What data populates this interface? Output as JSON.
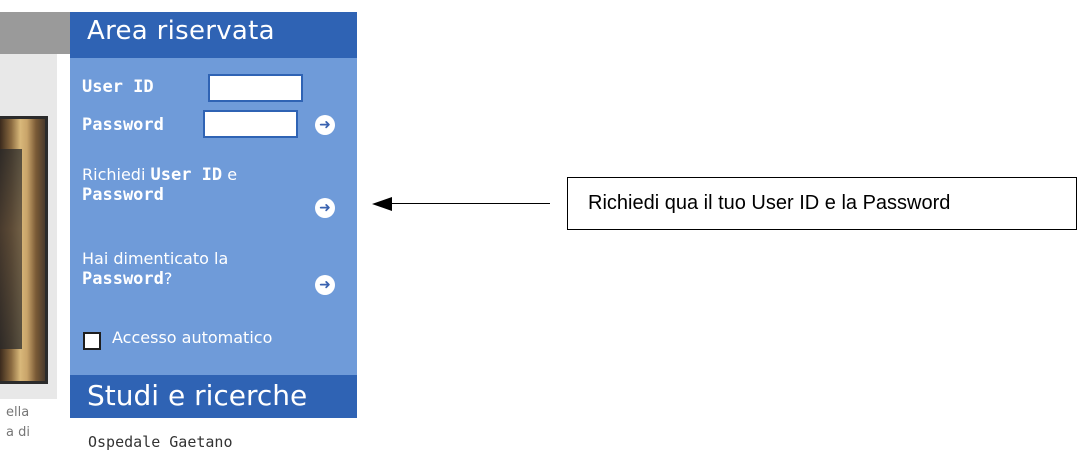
{
  "login_box": {
    "title": "Area riservata",
    "user_id_label": "User ID",
    "password_label": "Password",
    "request_text": "Richiedi",
    "request_user_id": "User ID",
    "request_and": "e",
    "request_password": "Password",
    "forgot_text": "Hai dimenticato la",
    "forgot_password": "Password",
    "forgot_q": "?",
    "auto_login": "Accesso automatico"
  },
  "section2": {
    "title": "Studi e ricerche",
    "line1": "Ospedale Gaetano"
  },
  "left_fragments": {
    "text1": "ella",
    "text2": "a di"
  },
  "annotation": {
    "callout_text": "Richiedi qua il tuo User ID e la Password"
  },
  "colors": {
    "panel_header": "#2f63b4",
    "panel_body": "#6f9bd9"
  },
  "icons": {
    "go": "arrow-right-circle",
    "checkbox": "checkbox-empty"
  }
}
